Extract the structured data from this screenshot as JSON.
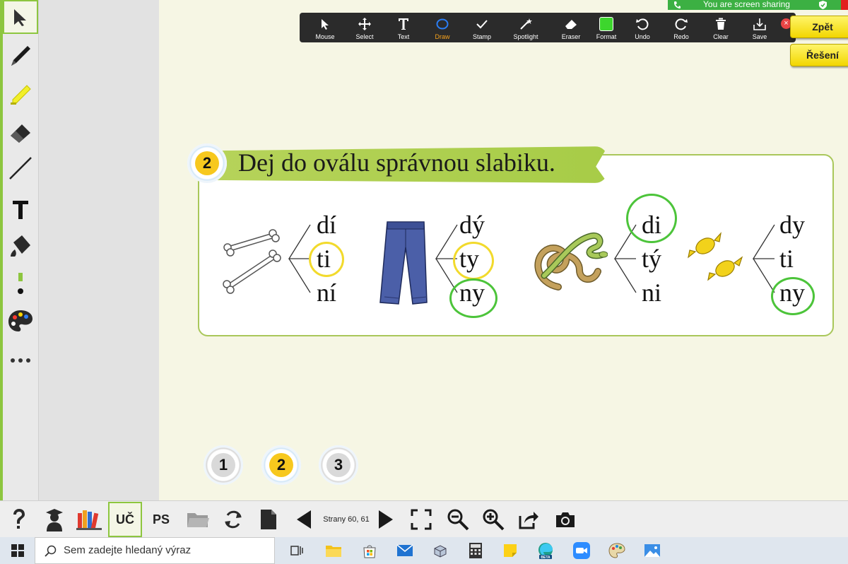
{
  "zoom_toolbar": {
    "items": [
      {
        "label": "Mouse",
        "icon": "cursor-icon"
      },
      {
        "label": "Select",
        "icon": "move-icon"
      },
      {
        "label": "Text",
        "icon": "text-icon"
      },
      {
        "label": "Draw",
        "icon": "circle-draw-icon"
      },
      {
        "label": "Stamp",
        "icon": "check-icon"
      },
      {
        "label": "Spotlight",
        "icon": "wand-icon"
      },
      {
        "label": "Eraser",
        "icon": "eraser-icon"
      },
      {
        "label": "Format",
        "icon": "color-square-icon"
      },
      {
        "label": "Undo",
        "icon": "undo-icon"
      },
      {
        "label": "Redo",
        "icon": "redo-icon"
      },
      {
        "label": "Clear",
        "icon": "trash-icon"
      },
      {
        "label": "Save",
        "icon": "save-icon"
      }
    ],
    "selected": "Draw",
    "format_color": "#3dd62d",
    "close": "×"
  },
  "share_banner": {
    "text": "You are screen sharing"
  },
  "nav_buttons": {
    "back": "Zpět",
    "solution": "Řešení"
  },
  "exercise": {
    "number": "2",
    "title": "Dej do oválu správnou slabiku.",
    "groups": [
      {
        "image": "bones",
        "syllables": [
          "dí",
          "ti",
          "ní"
        ],
        "circled": "ti",
        "circle_color": "yellow"
      },
      {
        "image": "trousers",
        "syllables": [
          "dý",
          "ty",
          "ny"
        ],
        "circled": [
          "ty",
          "ny"
        ],
        "circle_color": "yellow/green"
      },
      {
        "image": "snakes",
        "syllables": [
          "di",
          "tý",
          "ni"
        ],
        "circled": "di",
        "circle_color": "green"
      },
      {
        "image": "candies",
        "syllables": [
          "dy",
          "ti",
          "ny"
        ],
        "circled": "ny",
        "circle_color": "green"
      }
    ]
  },
  "page_selector": [
    "1",
    "2",
    "3"
  ],
  "bottom_bar": {
    "uc": "UČ",
    "ps": "PS",
    "pages": "Strany 60, 61"
  },
  "taskbar": {
    "search_placeholder": "Sem zadejte hledaný výraz"
  },
  "colors": {
    "accent_green": "#8dc63f",
    "oval_yellow": "#f2da2c",
    "oval_green": "#4cc43a",
    "banner_green": "#a7cc47"
  }
}
